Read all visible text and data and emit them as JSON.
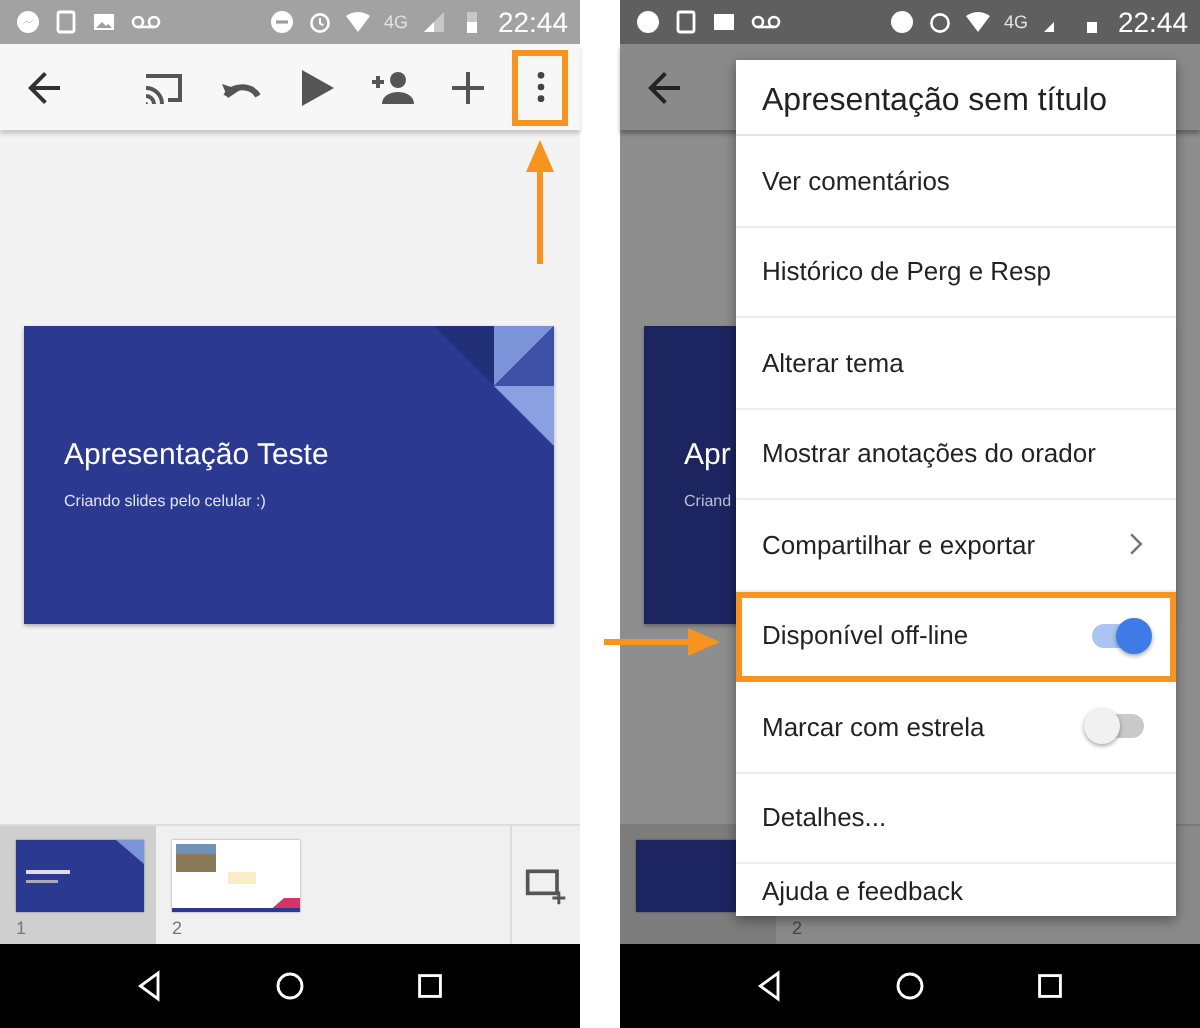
{
  "left_phone": {
    "status_bar": {
      "network": "4G",
      "time": "22:44"
    },
    "toolbar": [
      {
        "kind": "back",
        "highlighted": false
      },
      {
        "kind": "cast",
        "highlighted": false
      },
      {
        "kind": "undo",
        "highlighted": false
      },
      {
        "kind": "play",
        "highlighted": false
      },
      {
        "kind": "add-person",
        "highlighted": false
      },
      {
        "kind": "add",
        "highlighted": false
      },
      {
        "kind": "more",
        "highlighted": true
      }
    ],
    "slide": {
      "title": "Apresentação Teste",
      "subtitle": "Criando slides pelo celular :)"
    },
    "filmstrip": [
      {
        "number": "1",
        "kind": "title",
        "selected": true
      },
      {
        "number": "2",
        "kind": "photo",
        "selected": false
      }
    ]
  },
  "right_phone": {
    "scrim": true,
    "status_bar": {
      "network": "4G",
      "time": "22:44"
    },
    "slide": {
      "title": "Apr",
      "subtitle": "Criand"
    },
    "filmstrip": [
      {
        "number": "2"
      }
    ],
    "menu": {
      "title": "Apresentação sem título",
      "items": [
        {
          "label": "Ver comentários",
          "kind": "action",
          "highlighted": false
        },
        {
          "label": "Histórico de Perg e Resp",
          "kind": "action",
          "highlighted": false
        },
        {
          "label": "Alterar tema",
          "kind": "action",
          "highlighted": false
        },
        {
          "label": "Mostrar anotações do orador",
          "kind": "action",
          "highlighted": false
        },
        {
          "label": "Compartilhar e exportar",
          "kind": "submenu",
          "highlighted": false
        },
        {
          "label": "Disponível off-line",
          "kind": "toggle",
          "on": true,
          "highlighted": true
        },
        {
          "label": "Marcar com estrela",
          "kind": "toggle",
          "on": false,
          "highlighted": false
        },
        {
          "label": "Detalhes...",
          "kind": "action",
          "highlighted": false
        },
        {
          "label": "Ajuda e feedback",
          "kind": "action",
          "highlighted": false
        }
      ]
    }
  }
}
